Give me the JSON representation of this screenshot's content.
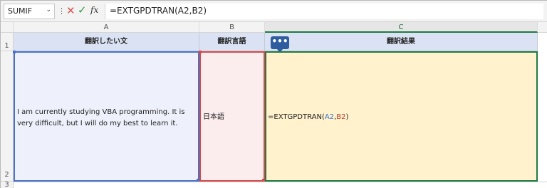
{
  "formula_bar": {
    "name_box": "SUMIF",
    "caret": "⌄",
    "dots": "⋮",
    "cancel_glyph": "✕",
    "enter_glyph": "✓",
    "fx_label": "fx",
    "formula": "=EXTGPDTRAN(A2,B2)"
  },
  "columns": [
    "A",
    "B",
    "C"
  ],
  "rows": [
    "1",
    "2",
    "3"
  ],
  "headers": {
    "a1": "翻訳したい文",
    "b1": "翻訳言語",
    "c1": "翻訳結果"
  },
  "comment_indicator": "•••",
  "cells": {
    "a2": "I am currently studying VBA programming. It is very difficult, but I will do my best to learn it.",
    "b2": "日本語",
    "c2": {
      "prefix": "=EXTGPDTRAN(",
      "ref1": "A2",
      "sep": ",",
      "ref2": "B2",
      "suffix": ")"
    }
  },
  "colors": {
    "ref_a": "#3b6fd4",
    "ref_b": "#c0392b",
    "selection": "#1f7a45",
    "header_fill": "#dbe2f4"
  }
}
